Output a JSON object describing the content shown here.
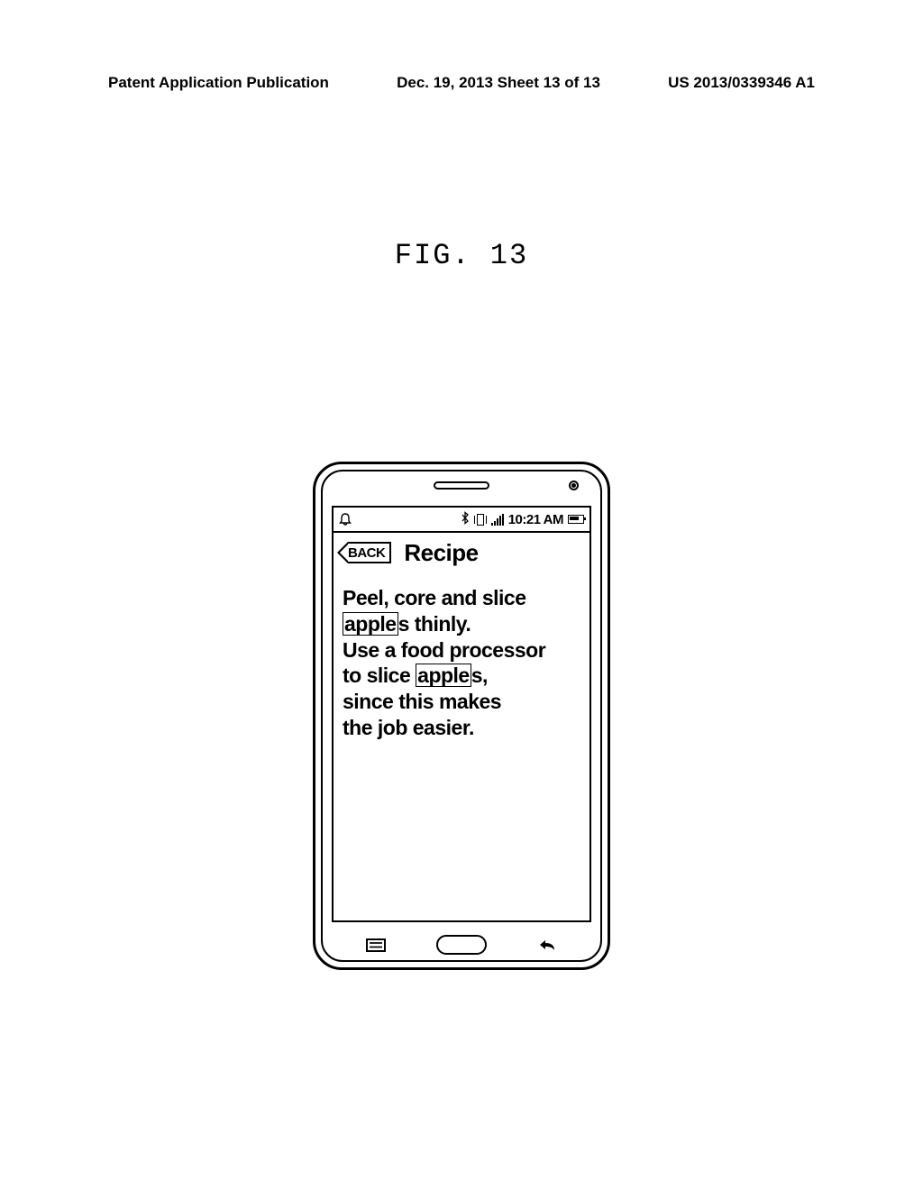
{
  "header": {
    "pub_label": "Patent Application Publication",
    "date_sheet": "Dec. 19, 2013   Sheet 13 of 13",
    "pub_number": "US 2013/0339346 A1"
  },
  "figure_label": "FIG. 13",
  "phone": {
    "status": {
      "time": "10:21 AM"
    },
    "back_button": "BACK",
    "title": "Recipe",
    "recipe": {
      "line1_pre": "Peel, core and slice",
      "line2_hl": "apple",
      "line2_post": "s thinly.",
      "line3": "Use a food processor",
      "line4_pre": "to slice ",
      "line4_hl": "apple",
      "line4_post": "s,",
      "line5": "since this makes",
      "line6": "the job easier."
    }
  }
}
